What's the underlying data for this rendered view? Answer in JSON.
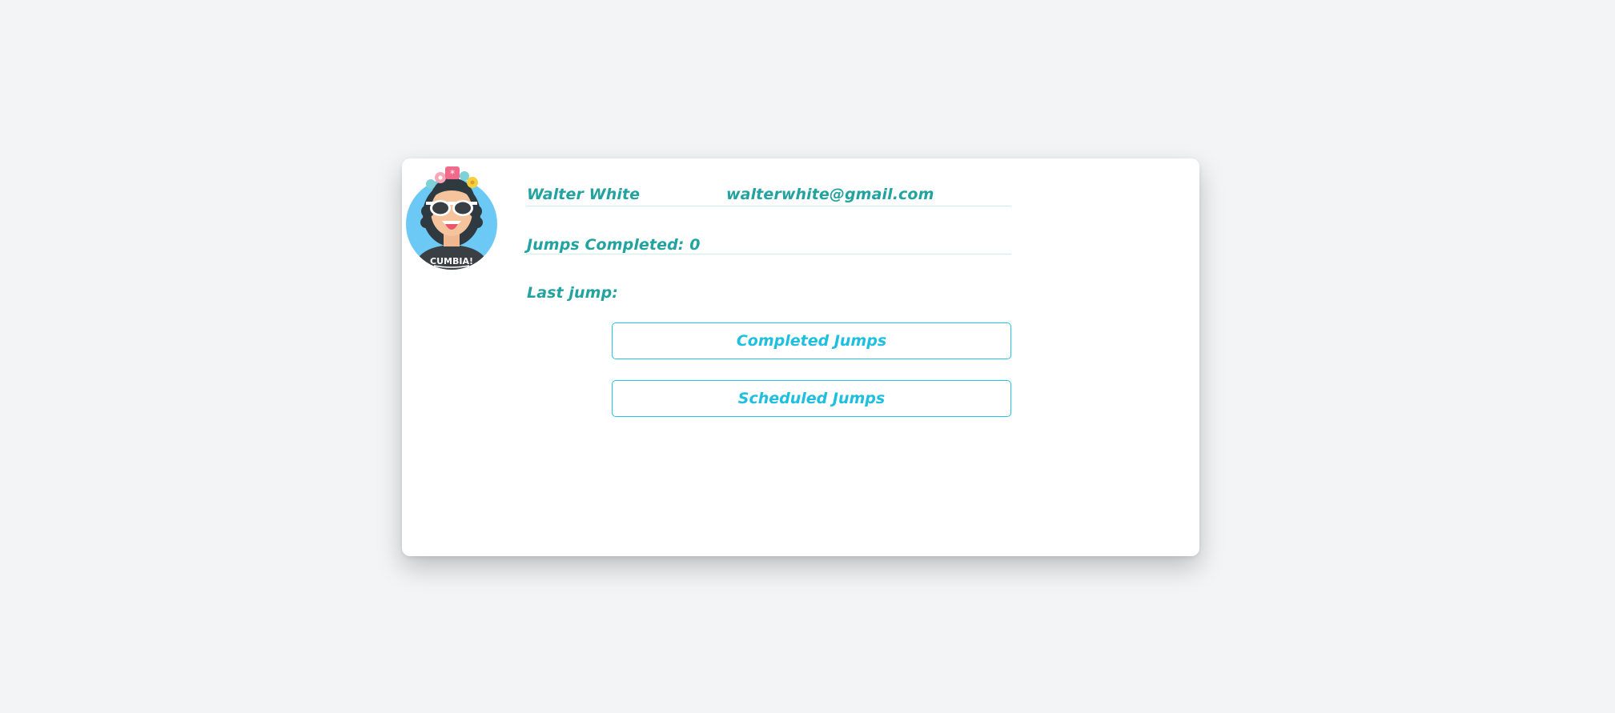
{
  "profile": {
    "name": "Walter White",
    "email": "walterwhite@gmail.com",
    "jumps_completed_label": "Jumps Completed: 0",
    "last_jump_label": "Last jump:",
    "avatar": {
      "icon": "avatar-cumbia-icon",
      "shirt_text": "CUMBIA!"
    }
  },
  "buttons": {
    "completed_label": "Completed Jumps",
    "scheduled_label": "Scheduled Jumps"
  },
  "colors": {
    "text_teal": "#22a39f",
    "button_cyan": "#22c3e6",
    "background": "#f3f4f6",
    "avatar_bg": "#6cc9f5"
  }
}
